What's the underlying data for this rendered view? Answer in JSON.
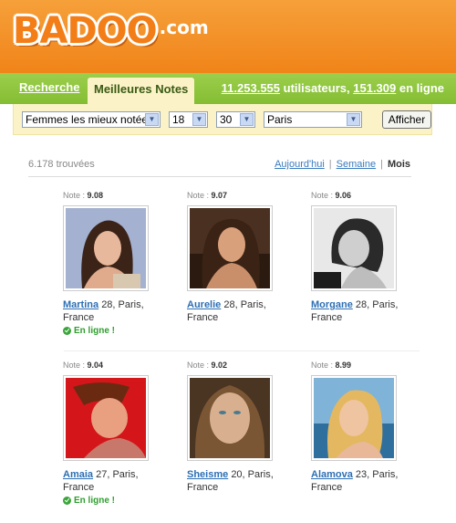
{
  "header": {
    "logo": "BADOO",
    "logo_suffix": ".com"
  },
  "nav": {
    "tab_search": "Recherche",
    "tab_top": "Meilleures Notes",
    "users_count": "11.253.555",
    "users_label": "utilisateurs,",
    "online_count": "151.309",
    "online_label": "en ligne"
  },
  "filters": {
    "category": "Femmes les mieux notées",
    "age_min": "18",
    "age_sep": "–",
    "age_max": "30",
    "city": "Paris",
    "submit": "Afficher"
  },
  "results": {
    "count": "6.178 trouvées",
    "period_day": "Aujourd'hui",
    "period_week": "Semaine",
    "period_month": "Mois"
  },
  "profiles": [
    {
      "note_label": "Note :",
      "note": "9.08",
      "name": "Martina",
      "age_city": "28, Paris,",
      "country": "France",
      "online": "En ligne !"
    },
    {
      "note_label": "Note :",
      "note": "9.07",
      "name": "Aurelie",
      "age_city": "28, Paris,",
      "country": "France",
      "online": ""
    },
    {
      "note_label": "Note :",
      "note": "9.06",
      "name": "Morgane",
      "age_city": "28, Paris,",
      "country": "France",
      "online": ""
    },
    {
      "note_label": "Note :",
      "note": "9.04",
      "name": "Amaia",
      "age_city": "27, Paris,",
      "country": "France",
      "online": "En ligne !"
    },
    {
      "note_label": "Note :",
      "note": "9.02",
      "name": "Sheisme",
      "age_city": "20, Paris,",
      "country": "France",
      "online": ""
    },
    {
      "note_label": "Note :",
      "note": "8.99",
      "name": "Alamova",
      "age_city": "23, Paris,",
      "country": "France",
      "online": ""
    }
  ],
  "colors": {
    "header_orange": "#f08419",
    "nav_green": "#8cc63f",
    "filter_cream": "#fbf3c7",
    "link_blue": "#2d6fb4",
    "online_green": "#2e9e2e"
  }
}
